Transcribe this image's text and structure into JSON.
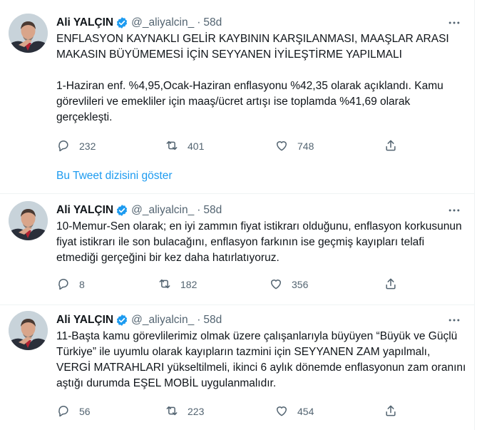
{
  "tweets": [
    {
      "author": "Ali YALÇIN",
      "handle": "@_aliyalcin_",
      "dot": "·",
      "time": "58d",
      "text": "ENFLASYON KAYNAKLI GELİR KAYBININ KARŞILANMASI, MAAŞLAR ARASI MAKASIN BÜYÜMEMESİ İÇİN SEYYANEN İYİLEŞTİRME YAPILMALI\n\n1-Haziran enf. %4,95,Ocak-Haziran enflasyonu %42,35 olarak açıklandı. Kamu görevlileri ve emekliler için maaş/ücret artışı ise toplamda %41,69 olarak gerçekleşti.",
      "replies": "232",
      "retweets": "401",
      "likes": "748",
      "show_thread": "Bu Tweet dizisini göster"
    },
    {
      "author": "Ali YALÇIN",
      "handle": "@_aliyalcin_",
      "dot": "·",
      "time": "58d",
      "text": "10-Memur-Sen olarak; en iyi zammın fiyat istikrarı olduğunu, enflasyon korkusunun fiyat istikrarı ile son bulacağını, enflasyon farkının ise geçmiş kayıpları telafi etmediği gerçeğini bir kez daha hatırlatıyoruz.",
      "replies": "8",
      "retweets": "182",
      "likes": "356"
    },
    {
      "author": "Ali YALÇIN",
      "handle": "@_aliyalcin_",
      "dot": "·",
      "time": "58d",
      "text": "11-Başta kamu görevlilerimiz olmak üzere çalışanlarıyla büyüyen “Büyük ve Güçlü Türkiye” ile uyumlu olarak kayıpların tazmini için SEYYANEN ZAM yapılmalı, VERGİ MATRAHLARI yükseltilmeli, ikinci 6 aylık dönemde enflasyonun zam oranını aştığı durumda EŞEL MOBİL uygulanmalıdır.",
      "replies": "56",
      "retweets": "223",
      "likes": "454"
    }
  ],
  "icons": {
    "verified": "verified-badge-icon",
    "more": "more-options-icon",
    "reply": "reply-icon",
    "retweet": "retweet-icon",
    "like": "like-icon",
    "share": "share-icon"
  },
  "colors": {
    "link": "#1d9bf0",
    "verified": "#1d9bf0",
    "muted": "#536471",
    "text": "#0f1419",
    "divider": "#eff3f4"
  }
}
